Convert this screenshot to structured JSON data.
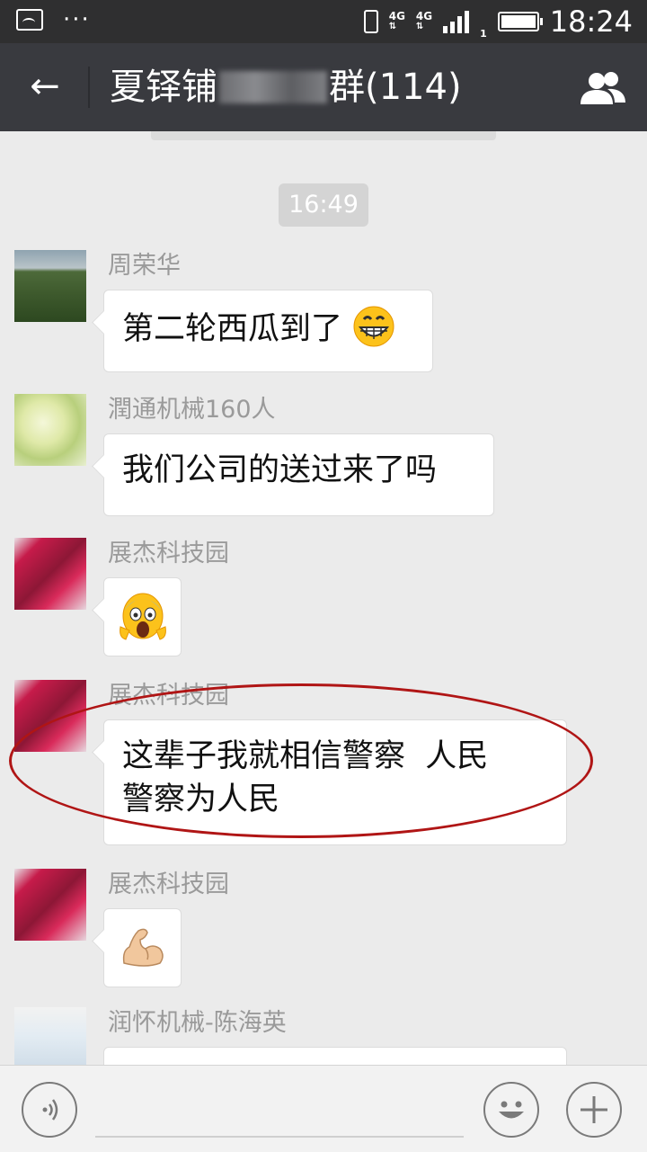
{
  "status_bar": {
    "network_label_1": "4G",
    "network_label_2": "4G",
    "sim_index": "1",
    "time": "18:24"
  },
  "header": {
    "title_prefix": "夏铎铺",
    "title_suffix": "群(114)"
  },
  "chat": {
    "time_divider": "16:49",
    "messages": [
      {
        "sender": "周荣华",
        "text": "第二轮西瓜到了",
        "emoji": "grinning-face"
      },
      {
        "sender": "潤通机械160人",
        "text": "我们公司的送过来了吗"
      },
      {
        "sender": "展杰科技园",
        "emoji": "screaming-face"
      },
      {
        "sender": "展杰科技园",
        "text_line1": "这辈子我就相信警察  人民",
        "text_line2": "警察为人民"
      },
      {
        "sender": "展杰科技园",
        "emoji": "flexed-biceps"
      },
      {
        "sender": "润怀机械-陈海英"
      }
    ]
  },
  "colors": {
    "status_bar_bg": "#2f2f30",
    "title_bar_bg": "#393a3f",
    "chat_bg": "#ebebeb",
    "highlight_ellipse": "#b01515"
  }
}
